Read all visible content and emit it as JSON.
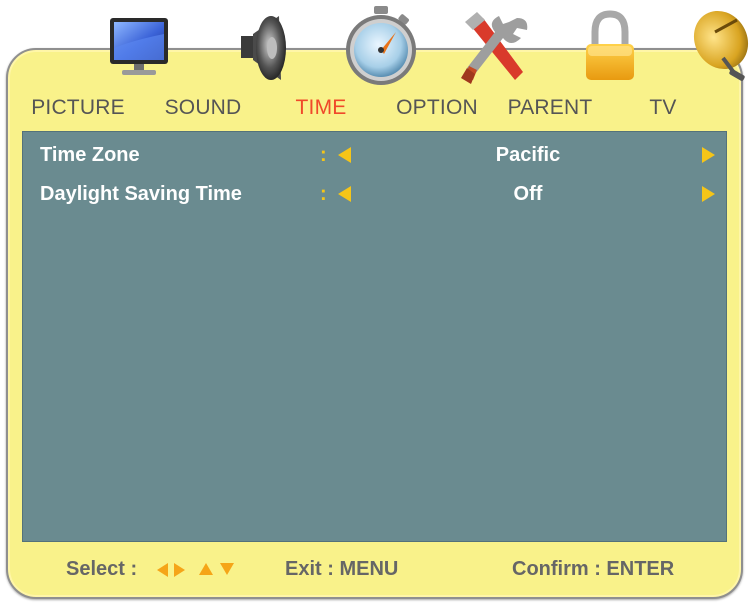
{
  "tabs": [
    {
      "label": "PICTURE",
      "icon": "monitor-icon"
    },
    {
      "label": "SOUND",
      "icon": "speaker-icon"
    },
    {
      "label": "TIME",
      "icon": "stopwatch-icon",
      "active": true
    },
    {
      "label": "OPTION",
      "icon": "tools-icon"
    },
    {
      "label": "PARENT",
      "icon": "lock-icon"
    },
    {
      "label": "TV",
      "icon": "satellite-dish-icon"
    }
  ],
  "settings": [
    {
      "label": "Time Zone",
      "colon": ":",
      "value": "Pacific"
    },
    {
      "label": "Daylight Saving Time",
      "colon": ":",
      "value": "Off"
    }
  ],
  "footer": {
    "select_label": "Select :",
    "exit_label": "Exit : MENU",
    "confirm_label": "Confirm : ENTER"
  },
  "colors": {
    "frame": "#f9f28a",
    "panel": "#6a8b90",
    "active_tab": "#f0492a",
    "arrow": "#f5c518"
  }
}
